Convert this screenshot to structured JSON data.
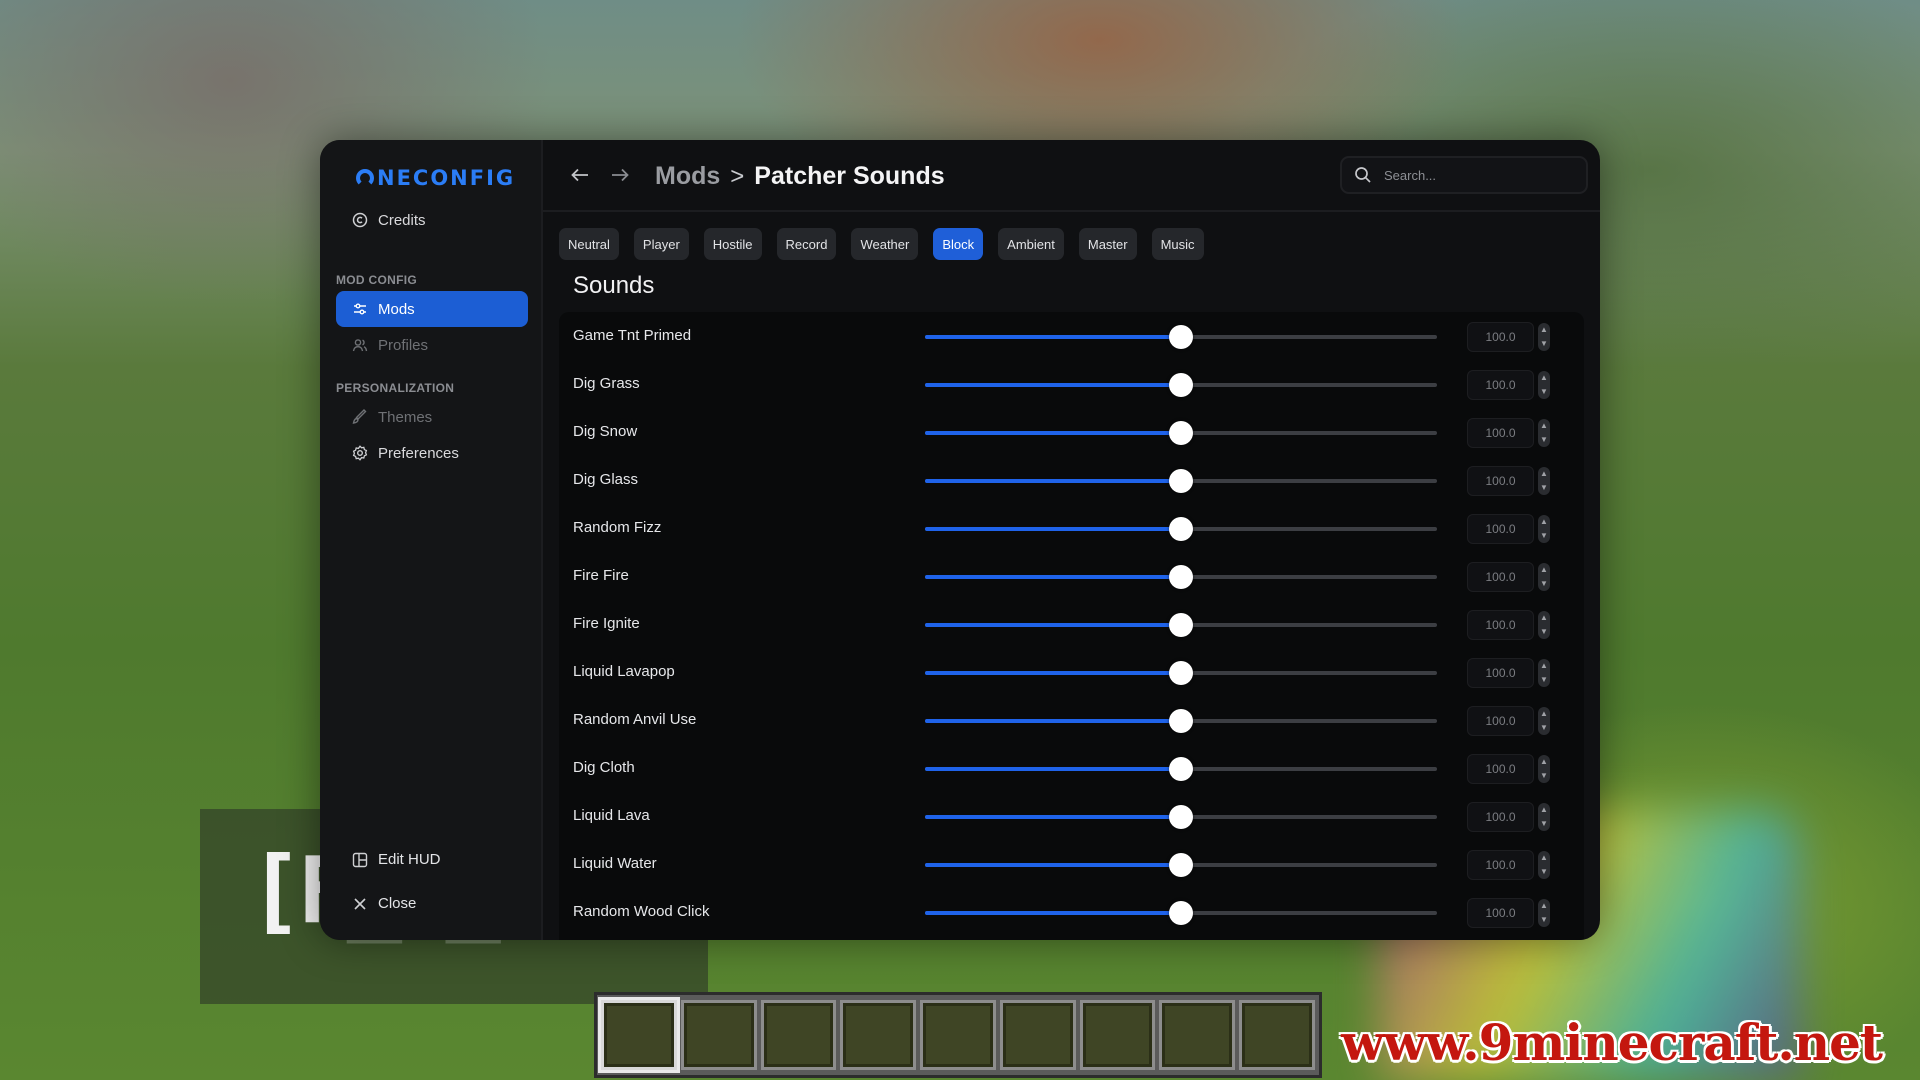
{
  "brand": {
    "logo_text": "NECONFIG",
    "accent": "#2b7df6"
  },
  "sidebar": {
    "items": [
      {
        "label": "Credits",
        "icon": "copyright-icon"
      }
    ],
    "sections": [
      {
        "title": "MOD CONFIG",
        "items": [
          {
            "label": "Mods",
            "icon": "sliders-icon",
            "active": true
          },
          {
            "label": "Profiles",
            "icon": "profiles-icon"
          }
        ]
      },
      {
        "title": "PERSONALIZATION",
        "items": [
          {
            "label": "Themes",
            "icon": "brush-icon"
          },
          {
            "label": "Preferences",
            "icon": "gear-icon"
          }
        ]
      }
    ],
    "bottom": [
      {
        "label": "Edit HUD",
        "icon": "layout-icon"
      },
      {
        "label": "Close",
        "icon": "close-icon"
      }
    ]
  },
  "header": {
    "breadcrumb_parent": "Mods",
    "breadcrumb_separator": ">",
    "breadcrumb_current": "Patcher Sounds",
    "search_placeholder": "Search..."
  },
  "tabs": [
    {
      "label": "Neutral"
    },
    {
      "label": "Player"
    },
    {
      "label": "Hostile"
    },
    {
      "label": "Record"
    },
    {
      "label": "Weather"
    },
    {
      "label": "Block",
      "active": true
    },
    {
      "label": "Ambient"
    },
    {
      "label": "Master"
    },
    {
      "label": "Music"
    }
  ],
  "section_title": "Sounds",
  "slider": {
    "min": 0,
    "max": 200
  },
  "sounds": [
    {
      "label": "Game Tnt Primed",
      "value": 100,
      "value_text": "100.0"
    },
    {
      "label": "Dig Grass",
      "value": 100,
      "value_text": "100.0"
    },
    {
      "label": "Dig Snow",
      "value": 100,
      "value_text": "100.0"
    },
    {
      "label": "Dig Glass",
      "value": 100,
      "value_text": "100.0"
    },
    {
      "label": "Random Fizz",
      "value": 100,
      "value_text": "100.0"
    },
    {
      "label": "Fire Fire",
      "value": 100,
      "value_text": "100.0"
    },
    {
      "label": "Fire Ignite",
      "value": 100,
      "value_text": "100.0"
    },
    {
      "label": "Liquid Lavapop",
      "value": 100,
      "value_text": "100.0"
    },
    {
      "label": "Random Anvil Use",
      "value": 100,
      "value_text": "100.0"
    },
    {
      "label": "Dig Cloth",
      "value": 100,
      "value_text": "100.0"
    },
    {
      "label": "Liquid Lava",
      "value": 100,
      "value_text": "100.0"
    },
    {
      "label": "Liquid Water",
      "value": 100,
      "value_text": "100.0"
    },
    {
      "label": "Random Wood Click",
      "value": 100,
      "value_text": "100.0"
    }
  ],
  "background": {
    "hud_text": "[F",
    "hotbar_slots": 9,
    "watermark": "www.9minecraft.net"
  }
}
